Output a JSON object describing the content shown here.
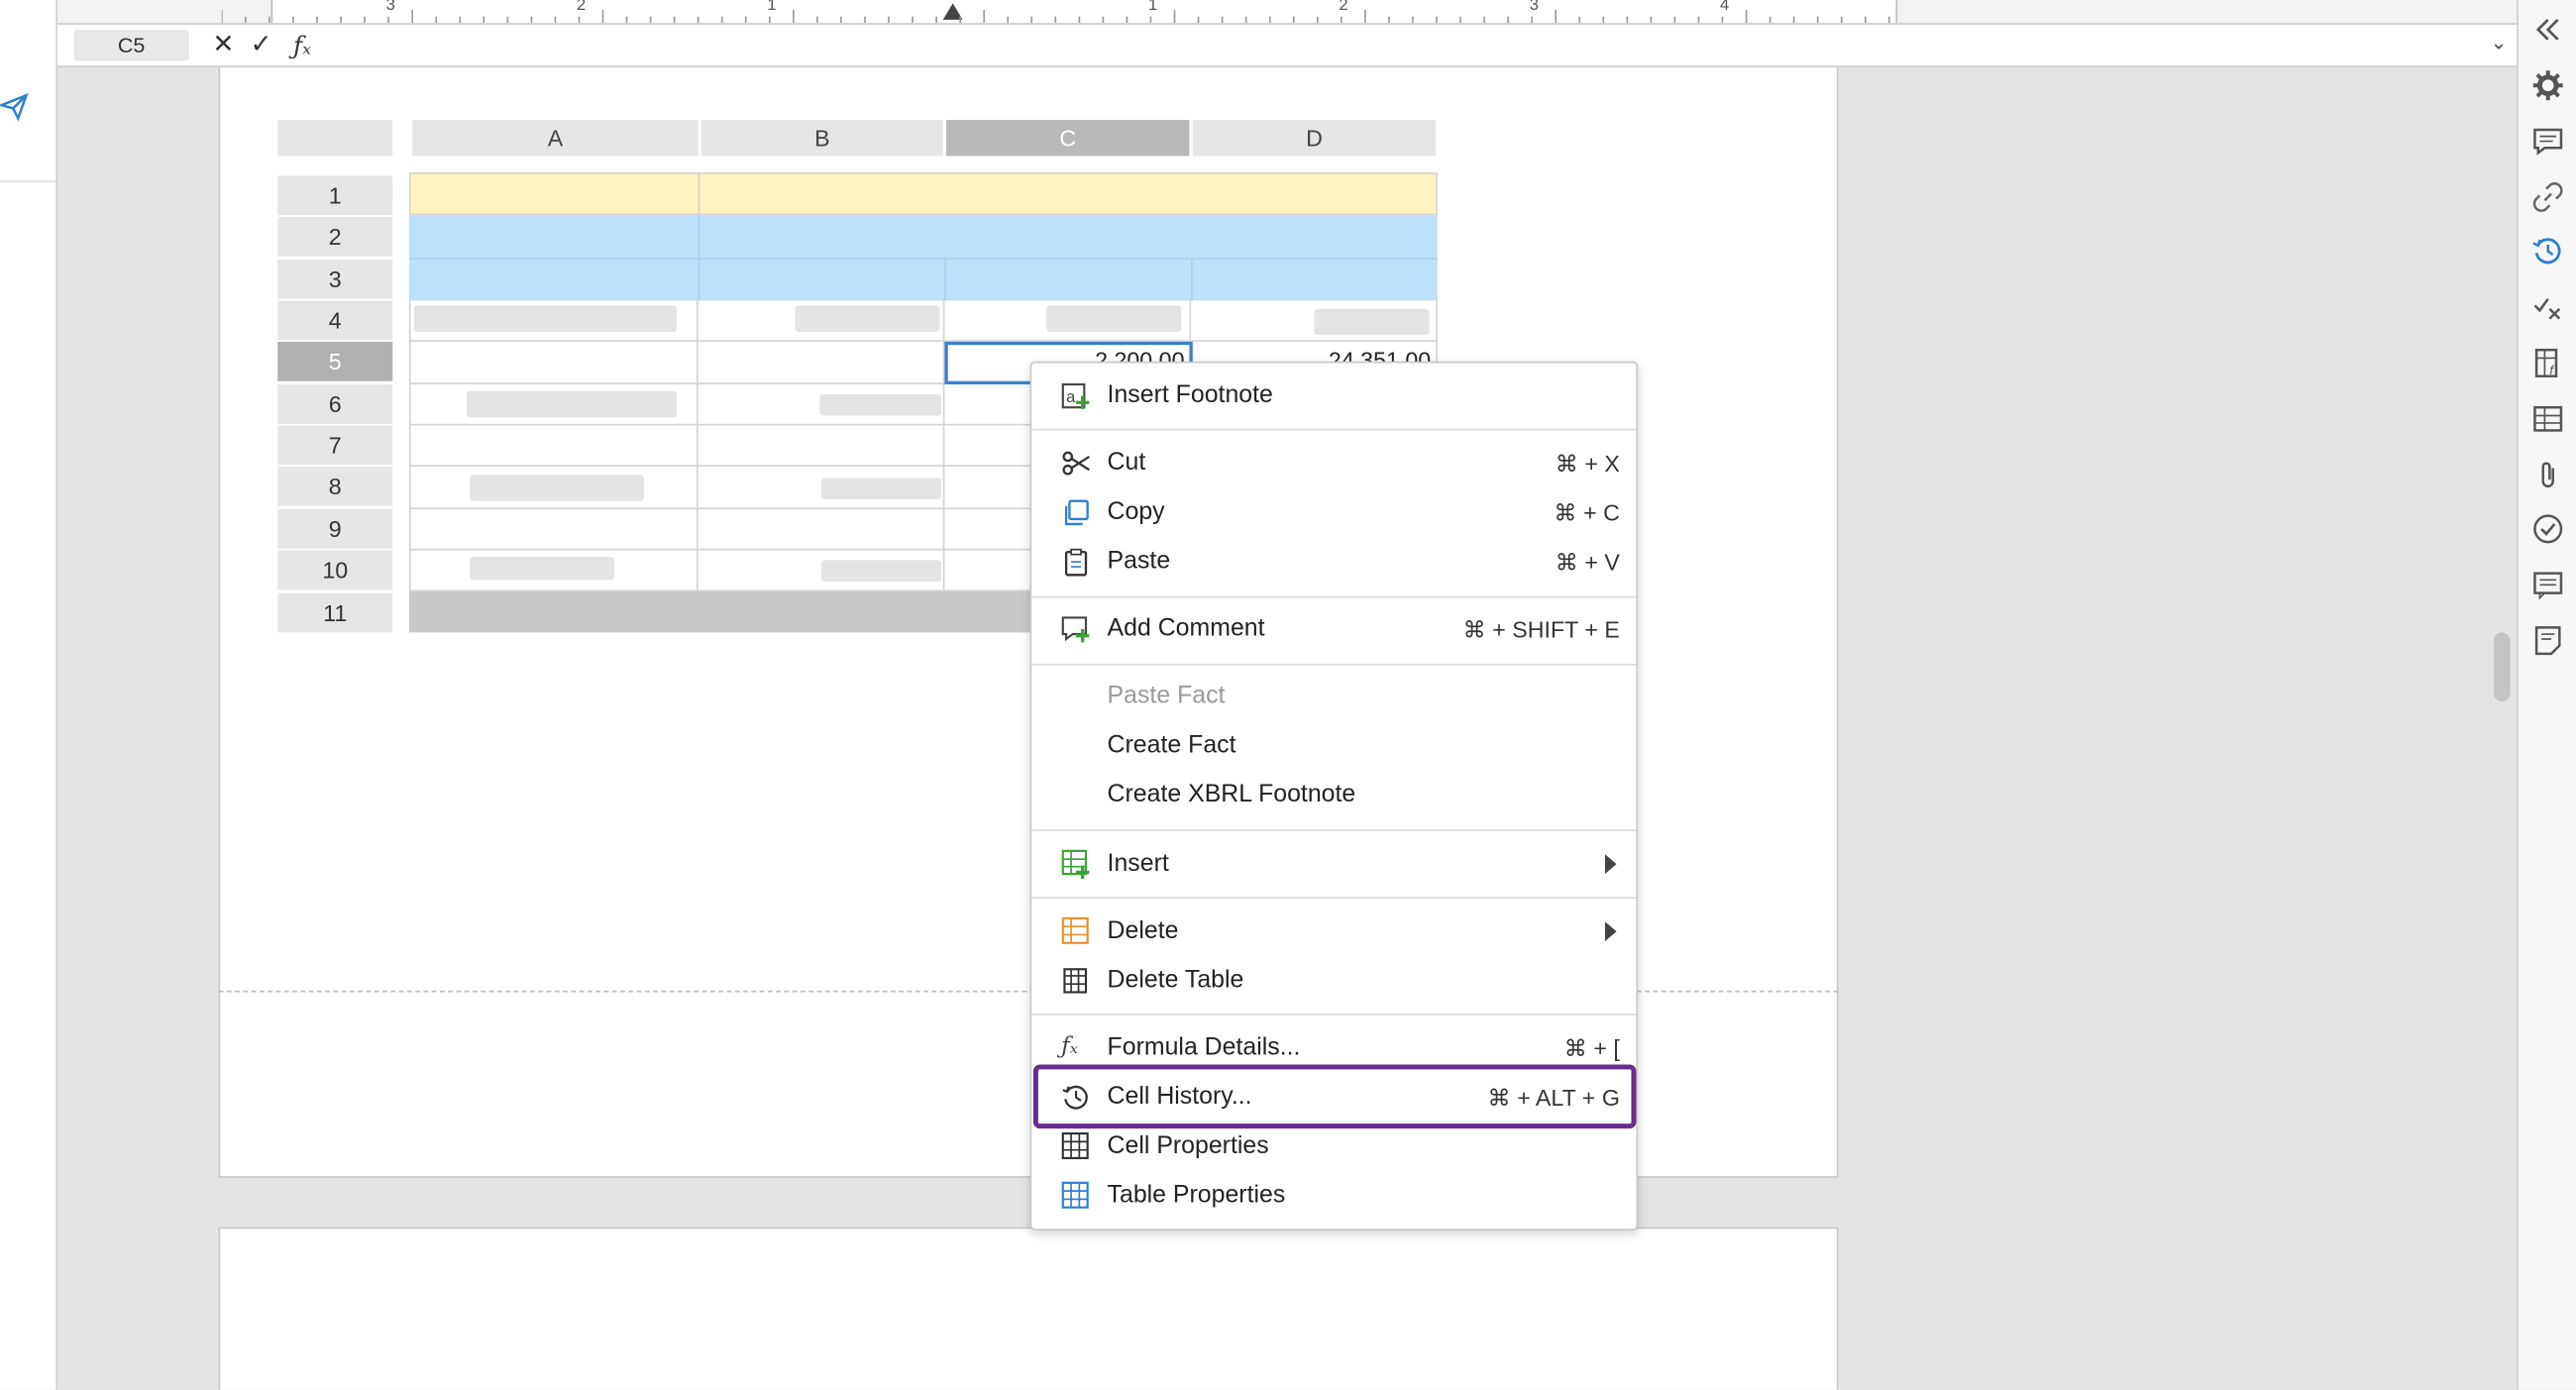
{
  "formula_bar": {
    "cell_ref": "C5"
  },
  "ruler": {
    "labels": [
      "3",
      "2",
      "1",
      "1",
      "2",
      "3",
      "4"
    ]
  },
  "table": {
    "columns": [
      "A",
      "B",
      "C",
      "D"
    ],
    "selected_column": "C",
    "rows": [
      "1",
      "2",
      "3",
      "4",
      "5",
      "6",
      "7",
      "8",
      "9",
      "10",
      "11"
    ],
    "selected_row": "5",
    "row5": {
      "c": "2,200.00",
      "d": "24,351.00"
    }
  },
  "context_menu": {
    "insert_footnote": "Insert Footnote",
    "cut": "Cut",
    "cut_sc": "⌘ + X",
    "copy": "Copy",
    "copy_sc": "⌘ + C",
    "paste": "Paste",
    "paste_sc": "⌘ + V",
    "add_comment": "Add Comment",
    "add_comment_sc": "⌘ + SHIFT + E",
    "paste_fact": "Paste Fact",
    "create_fact": "Create Fact",
    "create_xbrl_footnote": "Create XBRL Footnote",
    "insert": "Insert",
    "delete": "Delete",
    "delete_table": "Delete Table",
    "formula_details": "Formula Details...",
    "formula_details_sc": "⌘ + [",
    "cell_history": "Cell History...",
    "cell_history_sc": "⌘ + ALT + G",
    "cell_properties": "Cell Properties",
    "table_properties": "Table Properties"
  },
  "colors": {
    "accent_highlight": "#6a2c8e",
    "row1_fill": "#fdf2c0",
    "rows23_fill": "#bde0fb",
    "selection": "#3d7fd1"
  },
  "icons": [
    "send-icon",
    "collapse-panel-icon",
    "gear-icon",
    "comment-icon",
    "link-icon",
    "history-icon",
    "check-x-icon",
    "formula-table-icon",
    "table-icon",
    "paperclip-icon",
    "check-circle-icon",
    "notes-icon",
    "sticky-note-icon"
  ]
}
